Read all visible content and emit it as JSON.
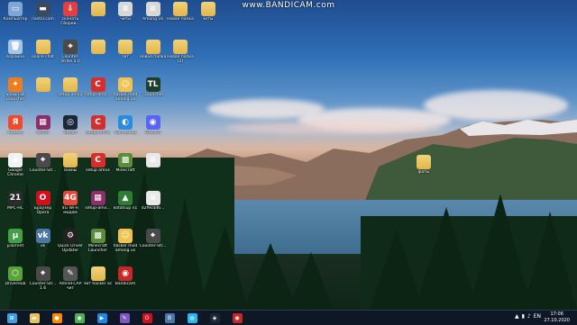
{
  "watermark": "www.BANDICAM.com",
  "desktop_icons": [
    {
      "label": "Компьютер",
      "icon": "computer-icon",
      "color": "#7fa7d6"
    },
    {
      "label": "nastol.com",
      "icon": "car-image-icon",
      "color": "#3a4a60"
    },
    {
      "label": "скачать Сборки...",
      "icon": "download-icon",
      "color": "#e04040"
    },
    {
      "label": "",
      "icon": "folder-icon",
      "color": "#e8c25a"
    },
    {
      "label": "читы",
      "icon": "document-icon",
      "color": "#d8d8d8"
    },
    {
      "label": "Among Us",
      "icon": "document-icon",
      "color": "#d8d8d8"
    },
    {
      "label": "Новая папка",
      "icon": "folder-icon",
      "color": "#e8c25a"
    },
    {
      "label": "читы",
      "icon": "folder-icon",
      "color": "#e8c25a"
    },
    {
      "label": "Корзина",
      "icon": "trash-icon",
      "color": "#a6c4e6"
    },
    {
      "label": "online chat",
      "icon": "folder-icon",
      "color": "#e8c25a"
    },
    {
      "label": "Counter-Strike 2.0",
      "icon": "csgo-icon",
      "color": "#4a4a4a"
    },
    {
      "label": "",
      "icon": "folder-icon",
      "color": "#e8c25a"
    },
    {
      "label": "чат",
      "icon": "folder-icon",
      "color": "#e8c25a"
    },
    {
      "label": "Новая папка",
      "icon": "folder-icon",
      "color": "#e8c25a"
    },
    {
      "label": "Новая папка (2)",
      "icon": "folder-icon",
      "color": "#e8c25a"
    },
    {
      "label": "Snow Fall Launcher",
      "icon": "launcher-icon",
      "color": "#ef7c1f"
    },
    {
      "label": "",
      "icon": "folder-icon",
      "color": "#e8c25a"
    },
    {
      "label": "setup amxx",
      "icon": "folder-icon",
      "color": "#e8c25a"
    },
    {
      "label": "setup-amx...",
      "icon": "ccleaner-icon",
      "color": "#d32f2f"
    },
    {
      "label": "hacker mod among us",
      "icon": "hacker-icon",
      "color": "#f2c14e"
    },
    {
      "label": "TLauncher",
      "icon": "tlauncher-icon",
      "color": "#1e3d2a"
    },
    {
      "label": "Яндекс",
      "icon": "yandex-icon",
      "color": "#f04a2b"
    },
    {
      "label": "winrar",
      "icon": "winrar-icon",
      "color": "#8b2e6b"
    },
    {
      "label": "Steam",
      "icon": "steam-icon",
      "color": "#1b2838"
    },
    {
      "label": "setup amxx",
      "icon": "ccleaner-icon",
      "color": "#d32f2f"
    },
    {
      "label": "GameLoop",
      "icon": "gameloop-icon",
      "color": "#2a8be0"
    },
    {
      "label": "Discord",
      "icon": "discord-icon",
      "color": "#5865f2"
    },
    {
      "label": "Google Chrome",
      "icon": "chrome-icon",
      "color": "#f2f2f2"
    },
    {
      "label": "Counter-Str...",
      "icon": "csgo-icon",
      "color": "#4a4a4a"
    },
    {
      "label": "скины",
      "icon": "folder-icon",
      "color": "#e8c25a"
    },
    {
      "label": "setup amxx",
      "icon": "ccleaner-icon",
      "color": "#d32f2f"
    },
    {
      "label": "Minecraft",
      "icon": "minecraft-icon",
      "color": "#5b8c3a"
    },
    {
      "label": "",
      "icon": "document-icon",
      "color": "#e8e8e8"
    },
    {
      "label": "MPC-HC",
      "icon": "mpc-icon",
      "color": "#2b2b2b"
    },
    {
      "label": "Браузер Opera",
      "icon": "opera-icon",
      "color": "#d0111b"
    },
    {
      "label": "4G Wi-Fi модем",
      "icon": "modem-icon",
      "color": "#e24a3a"
    },
    {
      "label": "setup-amx...",
      "icon": "winrar-icon",
      "color": "#8b2e6b"
    },
    {
      "label": "kotatsup v1",
      "icon": "triangle-icon",
      "color": "#2e7d32"
    },
    {
      "label": "d2f9cdd6...",
      "icon": "document-icon",
      "color": "#e8e8e8"
    },
    {
      "label": "µTorrent",
      "icon": "utorrent-icon",
      "color": "#43a047"
    },
    {
      "label": "vk",
      "icon": "vk-icon",
      "color": "#4a76a8"
    },
    {
      "label": "Quick Driver Updater",
      "icon": "driver-icon",
      "color": "#222"
    },
    {
      "label": "Minecraft Launcher",
      "icon": "minecraft-icon",
      "color": "#5b8c3a"
    },
    {
      "label": "hacker mod among us",
      "icon": "hacker-icon",
      "color": "#f2c14e"
    },
    {
      "label": "Counter-Str...",
      "icon": "csgo-icon",
      "color": "#4a4a4a"
    },
    {
      "label": "DriverHub",
      "icon": "driverhub-icon",
      "color": "#5aa23a"
    },
    {
      "label": "Counter-Str... 1.6",
      "icon": "csgo-icon",
      "color": "#4a4a4a"
    },
    {
      "label": "AmneFCAP чит",
      "icon": "tool-icon",
      "color": "#555"
    },
    {
      "label": "чит hacker ac",
      "icon": "folder-icon",
      "color": "#e8c25a"
    },
    {
      "label": "Bandicam",
      "icon": "bandicam-icon",
      "color": "#c62828"
    },
    {
      "label": "фаты",
      "icon": "folder-icon",
      "color": "#e8c25a"
    }
  ],
  "taskbar": {
    "apps": [
      {
        "name": "start-button",
        "glyph": "⊞",
        "color": "#3ea0e0"
      },
      {
        "name": "explorer",
        "glyph": "▬",
        "color": "#e8c25a"
      },
      {
        "name": "firefox",
        "glyph": "●",
        "color": "#ff8a00"
      },
      {
        "name": "chrome",
        "glyph": "◉",
        "color": "#4caf50"
      },
      {
        "name": "media",
        "glyph": "▶",
        "color": "#1e88e5"
      },
      {
        "name": "tool",
        "glyph": "✎",
        "color": "#7e57c2"
      },
      {
        "name": "opera",
        "glyph": "O",
        "color": "#d0111b"
      },
      {
        "name": "vk",
        "glyph": "В",
        "color": "#4a76a8"
      },
      {
        "name": "messenger",
        "glyph": "◍",
        "color": "#29b6f6"
      },
      {
        "name": "steam",
        "glyph": "◈",
        "color": "#1b2838"
      },
      {
        "name": "bandicam",
        "glyph": "◉",
        "color": "#c62828"
      }
    ],
    "tray": [
      "▲",
      "▮",
      "♪",
      "EN"
    ],
    "time": "17:06",
    "date": "27.10.2020"
  }
}
